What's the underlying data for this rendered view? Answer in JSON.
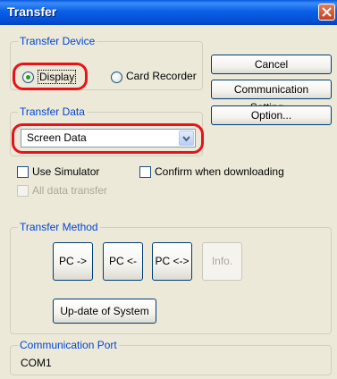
{
  "window": {
    "title": "Transfer"
  },
  "transfer_device": {
    "legend": "Transfer Device",
    "options": [
      "Display",
      "Card Recorder"
    ],
    "selected": "Display"
  },
  "buttons": {
    "cancel": "Cancel",
    "communication_setting": "Communication Setting...",
    "option": "Option..."
  },
  "transfer_data": {
    "legend": "Transfer Data",
    "selected_value": "Screen Data"
  },
  "checkboxes": {
    "use_simulator": "Use Simulator",
    "confirm_downloading": "Confirm when downloading",
    "all_data_transfer": "All data transfer"
  },
  "transfer_method": {
    "legend": "Transfer Method",
    "pc_to": "PC ->",
    "pc_from": "PC <-",
    "pc_both": "PC <->",
    "info": "Info.",
    "update_system": "Up-date of System"
  },
  "communication_port": {
    "legend": "Communication Port",
    "value": "COM1"
  },
  "colors": {
    "highlight": "#e8131a",
    "titlebar": "#0b60e6",
    "group_legend": "#0046d5",
    "radio_dot": "#21a121"
  }
}
